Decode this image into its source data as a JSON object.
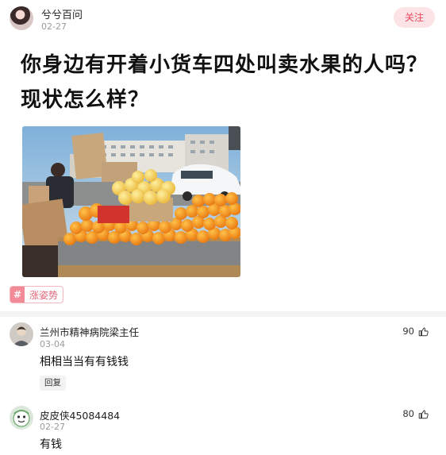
{
  "post": {
    "author": "兮兮百问",
    "date": "02-27",
    "follow_label": "关注",
    "title": "你身边有开着小货车四处叫卖水果的人吗？现状怎么样？",
    "topic": {
      "hash": "#",
      "label": "涨姿势"
    }
  },
  "comments": [
    {
      "name": "兰州市精神病院梁主任",
      "date": "03-04",
      "text": "相相当当有有钱钱",
      "reply_label": "回复",
      "likes": "90"
    },
    {
      "name": "皮皮侠45084484",
      "date": "02-27",
      "text": "有钱",
      "likes": "80"
    }
  ],
  "icons": {
    "like": "thumbs-up-icon",
    "topic": "hash-icon"
  },
  "colors": {
    "accent": "#e8455b",
    "follow_bg": "#fbe3e6",
    "topic": "#f28a98"
  }
}
